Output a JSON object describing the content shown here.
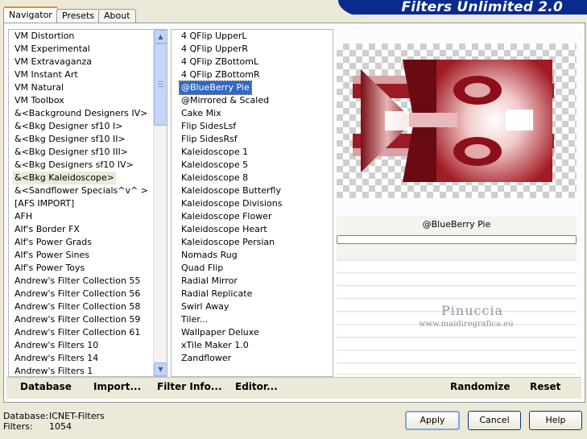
{
  "app": {
    "title": "Filters Unlimited 2.0"
  },
  "tabs": [
    {
      "label": "Navigator",
      "active": true
    },
    {
      "label": "Presets",
      "active": false
    },
    {
      "label": "About",
      "active": false
    }
  ],
  "categories": {
    "items": [
      "VM Distortion",
      "VM Experimental",
      "VM Extravaganza",
      "VM Instant Art",
      "VM Natural",
      "VM Toolbox",
      "&<Background Designers IV>",
      "&<Bkg Designer sf10 I>",
      "&<Bkg Designer sf10 II>",
      "&<Bkg Designer sf10 III>",
      "&<Bkg Designers sf10 IV>",
      "&<Bkg Kaleidoscope>",
      "&<Sandflower Specials^v^ >",
      "[AFS IMPORT]",
      "AFH",
      "Alf's Border FX",
      "Alf's Power Grads",
      "Alf's Power Sines",
      "Alf's Power Toys",
      "Andrew's Filter Collection 55",
      "Andrew's Filter Collection 56",
      "Andrew's Filter Collection 58",
      "Andrew's Filter Collection 59",
      "Andrew's Filter Collection 61",
      "Andrew's Filters 10",
      "Andrew's Filters 14",
      "Andrew's Filters 1"
    ],
    "current_index": 11
  },
  "filters": {
    "items": [
      "4 QFlip UpperL",
      "4 QFlip UpperR",
      "4 QFlip ZBottomL",
      "4 QFlip ZBottomR",
      "@BlueBerry Pie",
      "@Mirrored & Scaled",
      "Cake Mix",
      "Flip SidesLsf",
      "Flip SidesRsf",
      "Kaleidoscope 1",
      "Kaleidoscope 5",
      "Kaleidoscope 8",
      "Kaleidoscope Butterfly",
      "Kaleidoscope Divisions",
      "Kaleidoscope Flower",
      "Kaleidoscope Heart",
      "Kaleidoscope Persian",
      "Nomads Rug",
      "Quad Flip",
      "Radial Mirror",
      "Radial Replicate",
      "Swirl Away",
      "Tiler...",
      "Wallpaper Deluxe",
      "xTile Maker 1.0",
      "Zandflower"
    ],
    "selected_index": 4
  },
  "preview": {
    "filter_name": "@BlueBerry Pie"
  },
  "watermark": {
    "name": "Pinuccia",
    "url": "www.maidiregrafica.eu"
  },
  "toolbar": {
    "database": "Database",
    "import": "Import...",
    "filter_info": "Filter Info...",
    "editor": "Editor...",
    "randomize": "Randomize",
    "reset": "Reset"
  },
  "footer": {
    "database_label": "Database:",
    "database_value": "ICNET-Filters",
    "filters_label": "Filters:",
    "filters_value": "1054",
    "apply": "Apply",
    "cancel": "Cancel",
    "help": "Help"
  },
  "colors": {
    "title_banner": "#0a2a8c",
    "selection": "#316ac5",
    "tab_accent": "#e68b2c"
  }
}
